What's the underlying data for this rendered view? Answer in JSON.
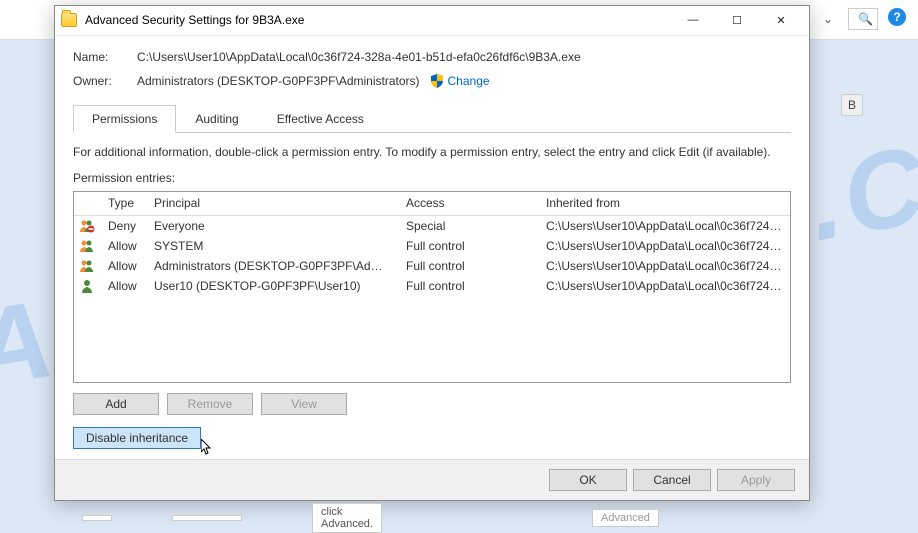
{
  "window": {
    "title": "Advanced Security Settings for 9B3A.exe"
  },
  "fields": {
    "name_label": "Name:",
    "name_value": "C:\\Users\\User10\\AppData\\Local\\0c36f724-328a-4e01-b51d-efa0c26fdf6c\\9B3A.exe",
    "owner_label": "Owner:",
    "owner_value": "Administrators (DESKTOP-G0PF3PF\\Administrators)",
    "change_link": "Change"
  },
  "tabs": {
    "permissions": "Permissions",
    "auditing": "Auditing",
    "effective": "Effective Access"
  },
  "info_text": "For additional information, double-click a permission entry. To modify a permission entry, select the entry and click Edit (if available).",
  "entries_label": "Permission entries:",
  "columns": {
    "type": "Type",
    "principal": "Principal",
    "access": "Access",
    "inherited": "Inherited from"
  },
  "rows": [
    {
      "icon": "group-deny",
      "type": "Deny",
      "principal": "Everyone",
      "access": "Special",
      "inherited": "C:\\Users\\User10\\AppData\\Local\\0c36f724-3..."
    },
    {
      "icon": "group",
      "type": "Allow",
      "principal": "SYSTEM",
      "access": "Full control",
      "inherited": "C:\\Users\\User10\\AppData\\Local\\0c36f724-3..."
    },
    {
      "icon": "group",
      "type": "Allow",
      "principal": "Administrators (DESKTOP-G0PF3PF\\Admini...",
      "access": "Full control",
      "inherited": "C:\\Users\\User10\\AppData\\Local\\0c36f724-3..."
    },
    {
      "icon": "user",
      "type": "Allow",
      "principal": "User10 (DESKTOP-G0PF3PF\\User10)",
      "access": "Full control",
      "inherited": "C:\\Users\\User10\\AppData\\Local\\0c36f724-3..."
    }
  ],
  "buttons": {
    "add": "Add",
    "remove": "Remove",
    "view": "View",
    "disable_inheritance": "Disable inheritance",
    "ok": "OK",
    "cancel": "Cancel",
    "apply": "Apply"
  },
  "background": {
    "advanced_partial": "Advanced",
    "click_advanced": "click Advanced.",
    "b_button": "B"
  },
  "watermark": "MYANTISPYWARE.COM"
}
